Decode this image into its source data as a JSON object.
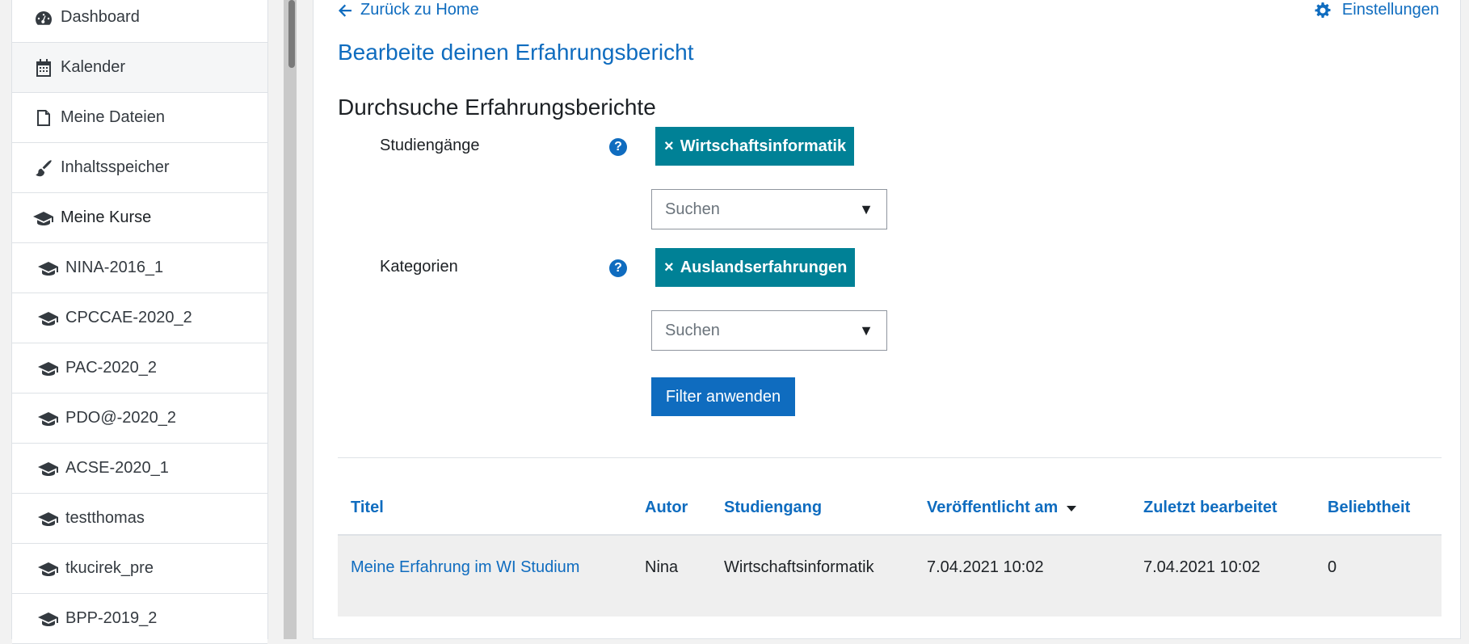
{
  "sidebar": {
    "items": [
      {
        "label": "Dashboard",
        "icon": "tachometer-icon"
      },
      {
        "label": "Kalender",
        "icon": "calendar-icon"
      },
      {
        "label": "Meine Dateien",
        "icon": "file-icon"
      },
      {
        "label": "Inhaltsspeicher",
        "icon": "paintbrush-icon"
      },
      {
        "label": "Meine Kurse",
        "icon": "graduation-cap-icon"
      },
      {
        "label": "NINA-2016_1",
        "icon": "graduation-cap-icon"
      },
      {
        "label": "CPCCAE-2020_2",
        "icon": "graduation-cap-icon"
      },
      {
        "label": "PAC-2020_2",
        "icon": "graduation-cap-icon"
      },
      {
        "label": "PDO@-2020_2",
        "icon": "graduation-cap-icon"
      },
      {
        "label": "ACSE-2020_1",
        "icon": "graduation-cap-icon"
      },
      {
        "label": "testthomas",
        "icon": "graduation-cap-icon"
      },
      {
        "label": "tkucirek_pre",
        "icon": "graduation-cap-icon"
      },
      {
        "label": "BPP-2019_2",
        "icon": "graduation-cap-icon"
      }
    ]
  },
  "header": {
    "back_label": "Zurück zu Home",
    "settings_label": "Einstellungen"
  },
  "page": {
    "title": "Bearbeite deinen Erfahrungsbericht",
    "search_heading": "Durchsuche Erfahrungsberichte"
  },
  "filters": {
    "studiengaenge": {
      "label": "Studiengänge",
      "selected_tag": "Wirtschaftsinformatik",
      "placeholder": "Suchen"
    },
    "kategorien": {
      "label": "Kategorien",
      "selected_tag": "Auslandserfahrungen",
      "placeholder": "Suchen"
    },
    "tag_remove_symbol": "×",
    "dropdown_arrow": "▼",
    "apply_label": "Filter anwenden"
  },
  "table": {
    "headers": {
      "titel": "Titel",
      "autor": "Autor",
      "studiengang": "Studiengang",
      "veroeffentlicht": "Veröffentlicht am",
      "zuletzt": "Zuletzt bearbeitet",
      "beliebtheit": "Beliebtheit"
    },
    "rows": [
      {
        "titel": "Meine Erfahrung im WI Studium",
        "autor": "Nina",
        "studiengang": "Wirtschaftsinformatik",
        "veroeffentlicht": "7.04.2021 10:02",
        "zuletzt": "7.04.2021 10:02",
        "beliebtheit": "0"
      }
    ]
  },
  "colors": {
    "link": "#0f6cbf",
    "tag": "#008196",
    "primary_button": "#0f6cbf"
  }
}
